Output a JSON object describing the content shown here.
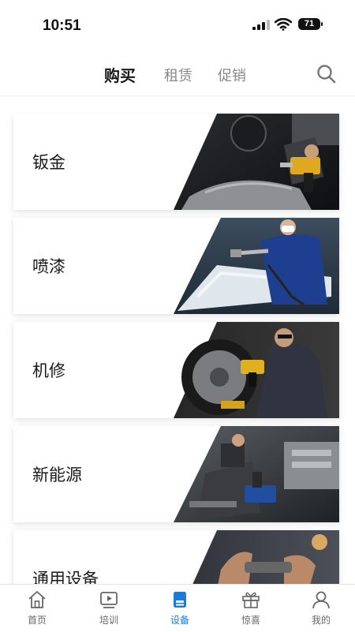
{
  "status_bar": {
    "time": "10:51",
    "battery": "71"
  },
  "top_tabs": [
    {
      "label": "购买",
      "active": true
    },
    {
      "label": "租赁",
      "active": false
    },
    {
      "label": "促销",
      "active": false
    }
  ],
  "categories": [
    {
      "label": "钣金",
      "image": "technician-drilling-car-body-photo"
    },
    {
      "label": "喷漆",
      "image": "painter-spray-gun-photo"
    },
    {
      "label": "机修",
      "image": "mechanic-impact-wrench-wheel-photo"
    },
    {
      "label": "新能源",
      "image": "workbench-power-tools-photo"
    },
    {
      "label": "通用设备",
      "image": "hands-with-tool-photo"
    }
  ],
  "bottom_nav": [
    {
      "label": "首页",
      "icon": "home-icon",
      "active": false
    },
    {
      "label": "培训",
      "icon": "video-play-icon",
      "active": false
    },
    {
      "label": "设备",
      "icon": "device-icon",
      "active": true
    },
    {
      "label": "惊喜",
      "icon": "gift-icon",
      "active": false
    },
    {
      "label": "我的",
      "icon": "person-icon",
      "active": false
    }
  ],
  "colors": {
    "accent": "#1d7bd8",
    "text": "#1a1a1a",
    "muted": "#888888"
  }
}
